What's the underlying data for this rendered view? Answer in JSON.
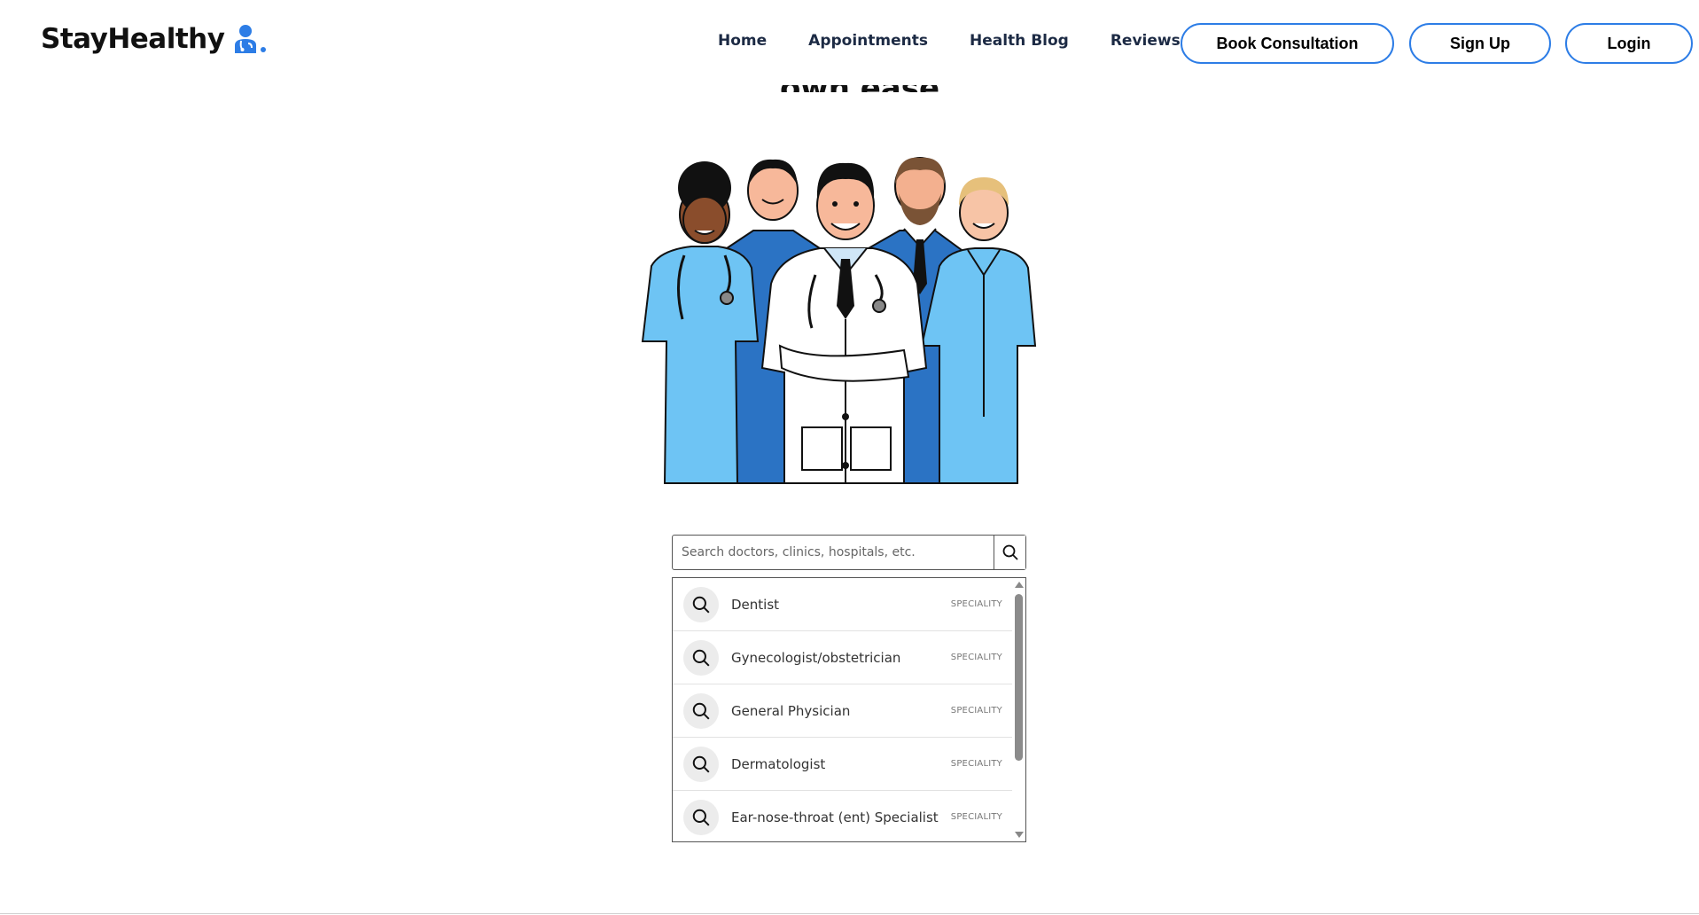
{
  "brand": {
    "name": "StayHealthy",
    "logo_icon": "doctor-logo-icon",
    "logo_color": "#2d7de6"
  },
  "nav": {
    "links": [
      "Home",
      "Appointments",
      "Health Blog",
      "Reviews"
    ],
    "book_label": "Book Consultation",
    "signup_label": "Sign Up",
    "login_label": "Login",
    "button_border_color": "#2d7de6"
  },
  "hero": {
    "heading_partial": "Find a doctor at your own ease",
    "illustration": "medical-team-illustration"
  },
  "search": {
    "placeholder": "Search doctors, clinics, hospitals, etc.",
    "icon": "search-icon"
  },
  "suggestions": [
    {
      "name": "Dentist",
      "tag": "SPECIALITY"
    },
    {
      "name": "Gynecologist/obstetrician",
      "tag": "SPECIALITY"
    },
    {
      "name": "General Physician",
      "tag": "SPECIALITY"
    },
    {
      "name": "Dermatologist",
      "tag": "SPECIALITY"
    },
    {
      "name": "Ear-nose-throat (ent) Specialist",
      "tag": "SPECIALITY"
    }
  ]
}
